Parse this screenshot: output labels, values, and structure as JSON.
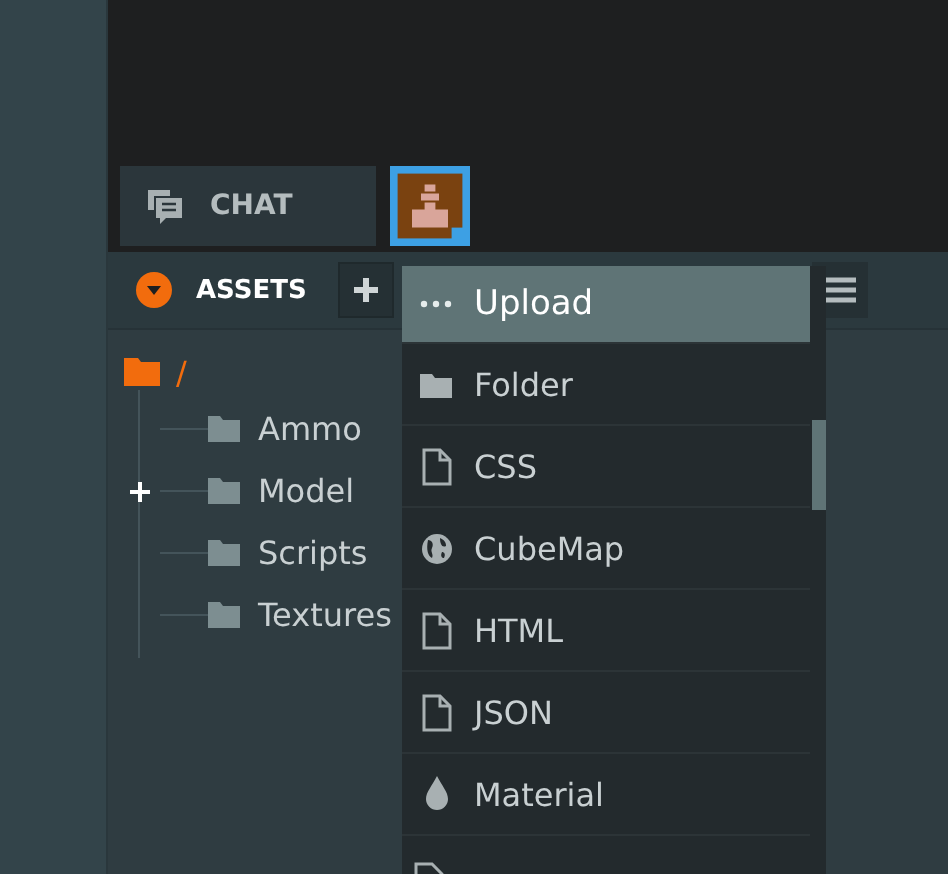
{
  "chat_tab": {
    "label": "CHAT"
  },
  "assets": {
    "title": "ASSETS",
    "expanded": true,
    "tree": {
      "label": "/",
      "expanded": true,
      "children": [
        {
          "label": "Ammo",
          "expandable": false
        },
        {
          "label": "Model",
          "expandable": true
        },
        {
          "label": "Scripts",
          "expandable": false
        },
        {
          "label": "Textures",
          "expandable": false
        }
      ]
    }
  },
  "menu": {
    "items": [
      {
        "label": "Upload",
        "kind": "upload",
        "selected": true
      },
      {
        "label": "Folder",
        "kind": "folder",
        "selected": false
      },
      {
        "label": "CSS",
        "kind": "file",
        "selected": false
      },
      {
        "label": "CubeMap",
        "kind": "globe",
        "selected": false
      },
      {
        "label": "HTML",
        "kind": "file",
        "selected": false
      },
      {
        "label": "JSON",
        "kind": "file",
        "selected": false
      },
      {
        "label": "Material",
        "kind": "drop",
        "selected": false
      }
    ]
  }
}
